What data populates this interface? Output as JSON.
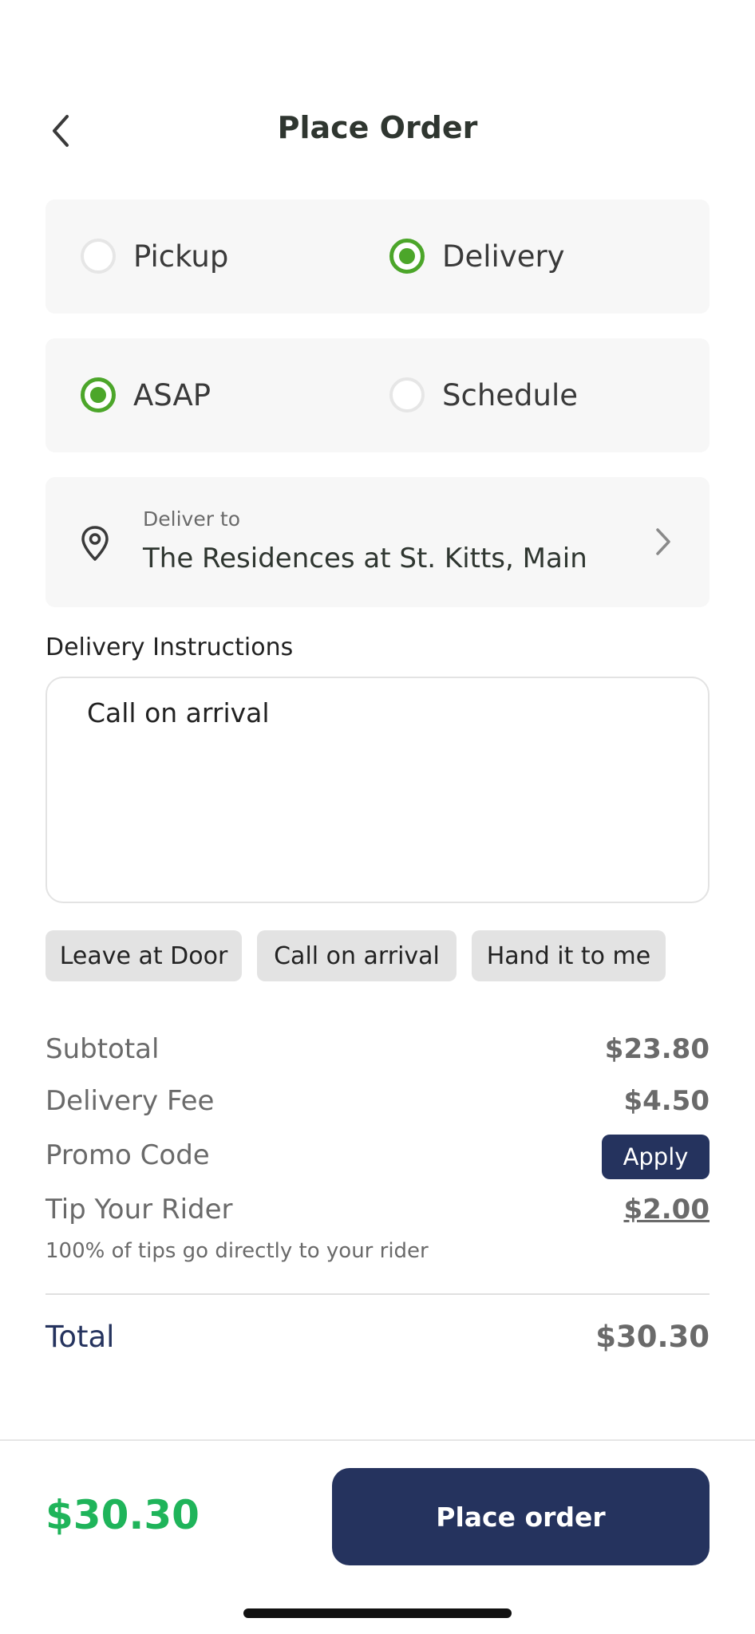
{
  "header": {
    "title": "Place Order"
  },
  "fulfillment": {
    "pickup_label": "Pickup",
    "delivery_label": "Delivery",
    "selected": "delivery"
  },
  "timing": {
    "asap_label": "ASAP",
    "schedule_label": "Schedule",
    "selected": "asap"
  },
  "deliver_to": {
    "label": "Deliver to",
    "address": "The Residences at St. Kitts, Main"
  },
  "instructions": {
    "label": "Delivery Instructions",
    "value": "Call on arrival",
    "chips": [
      "Leave at Door",
      "Call on arrival",
      "Hand it to me"
    ]
  },
  "summary": {
    "subtotal_label": "Subtotal",
    "subtotal_value": "$23.80",
    "delivery_fee_label": "Delivery Fee",
    "delivery_fee_value": "$4.50",
    "promo_label": "Promo Code",
    "apply_label": "Apply",
    "tip_label": "Tip Your Rider",
    "tip_value": "$2.00",
    "tip_note": "100% of tips go directly to your rider",
    "total_label": "Total",
    "total_value": "$30.30"
  },
  "footer": {
    "total": "$30.30",
    "place_order_label": "Place order"
  },
  "colors": {
    "accent_green": "#4ca62a",
    "navy": "#25335e",
    "price_green": "#1fb45a"
  }
}
